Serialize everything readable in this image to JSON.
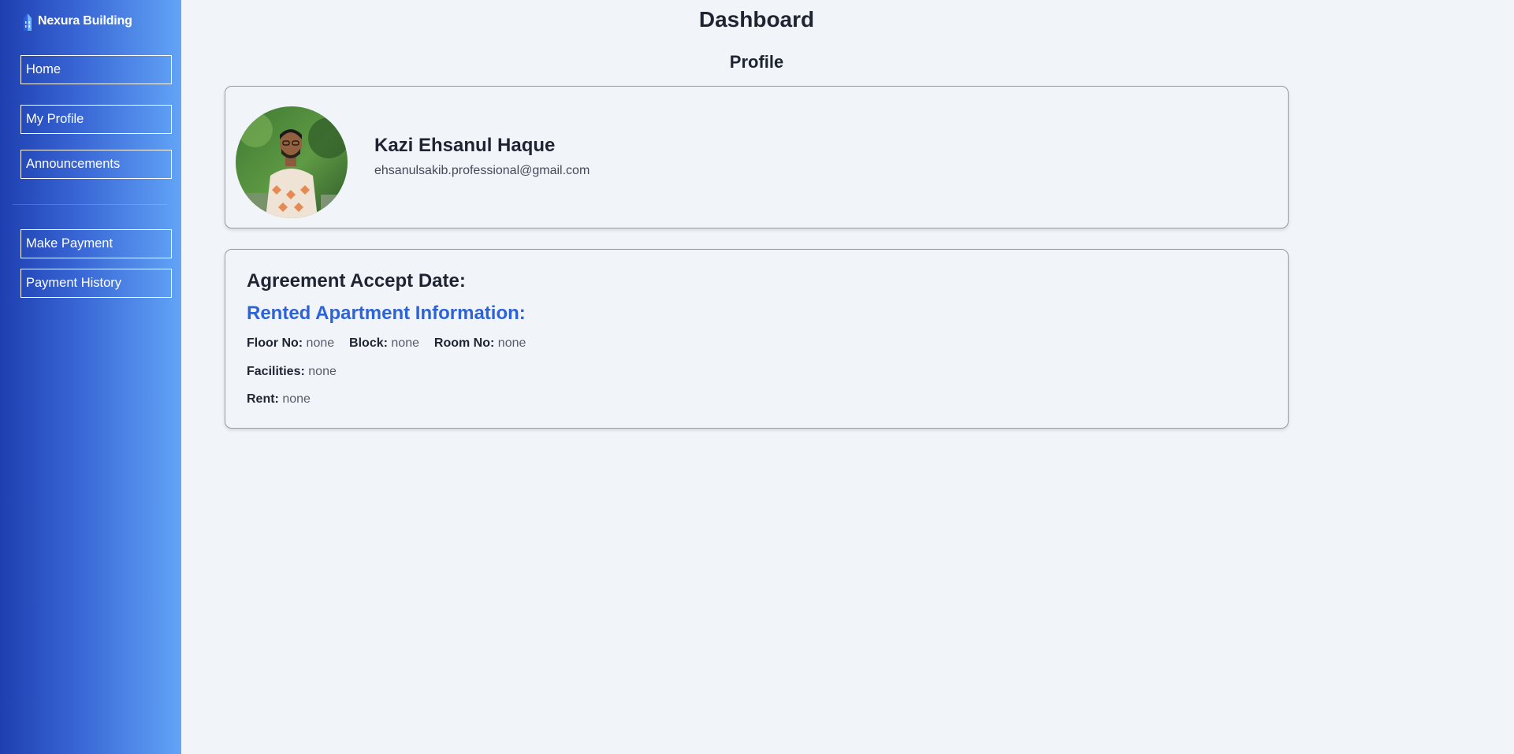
{
  "app": {
    "brand_name": "Nexura Building"
  },
  "sidebar": {
    "items": [
      {
        "label": "Home"
      },
      {
        "label": "My Profile"
      },
      {
        "label": "Announcements"
      },
      {
        "label": "Make Payment"
      },
      {
        "label": "Payment History"
      }
    ]
  },
  "header": {
    "title": "Dashboard"
  },
  "profile": {
    "section_title": "Profile",
    "name": "Kazi Ehsanul Haque",
    "email": "ehsanulsakib.professional@gmail.com"
  },
  "rental": {
    "agreement_label": "Agreement Accept Date:",
    "heading": "Rented Apartment Information:",
    "floor_label": "Floor No:",
    "floor_value": "none",
    "block_label": "Block:",
    "block_value": "none",
    "room_label": "Room No:",
    "room_value": "none",
    "facilities_label": "Facilities:",
    "facilities_value": "none",
    "rent_label": "Rent:",
    "rent_value": "none"
  },
  "colors": {
    "sidebar_gradient_start": "#1e3fb0",
    "sidebar_gradient_end": "#62a4f7",
    "accent_heading": "#2d63d8",
    "background": "#f1f4f9"
  },
  "icons": {
    "brand": "building-icon"
  }
}
